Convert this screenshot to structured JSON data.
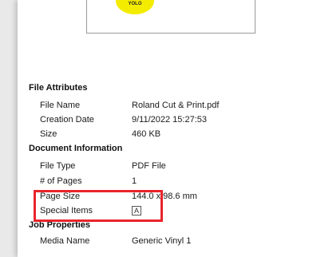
{
  "preview": {
    "sticker_text": "YOLO"
  },
  "file_attributes": {
    "heading": "File Attributes",
    "rows": [
      {
        "label": "File Name",
        "value": "Roland Cut & Print.pdf"
      },
      {
        "label": "Creation Date",
        "value": "9/11/2022 15:27:53"
      },
      {
        "label": "Size",
        "value": "460 KB"
      }
    ]
  },
  "document_information": {
    "heading": "Document Information",
    "rows": [
      {
        "label": "File Type",
        "value": "PDF File"
      },
      {
        "label": "# of Pages",
        "value": "1"
      },
      {
        "label": "Page Size",
        "value": "144.0 x 98.6 mm"
      },
      {
        "label": "Special Items",
        "value": "A"
      }
    ]
  },
  "job_properties": {
    "heading": "Job Properties",
    "rows": [
      {
        "label": "Media Name",
        "value": "Generic Vinyl 1"
      }
    ]
  },
  "colors": {
    "highlight": "#e8242a",
    "sticker": "#f4ec00"
  }
}
